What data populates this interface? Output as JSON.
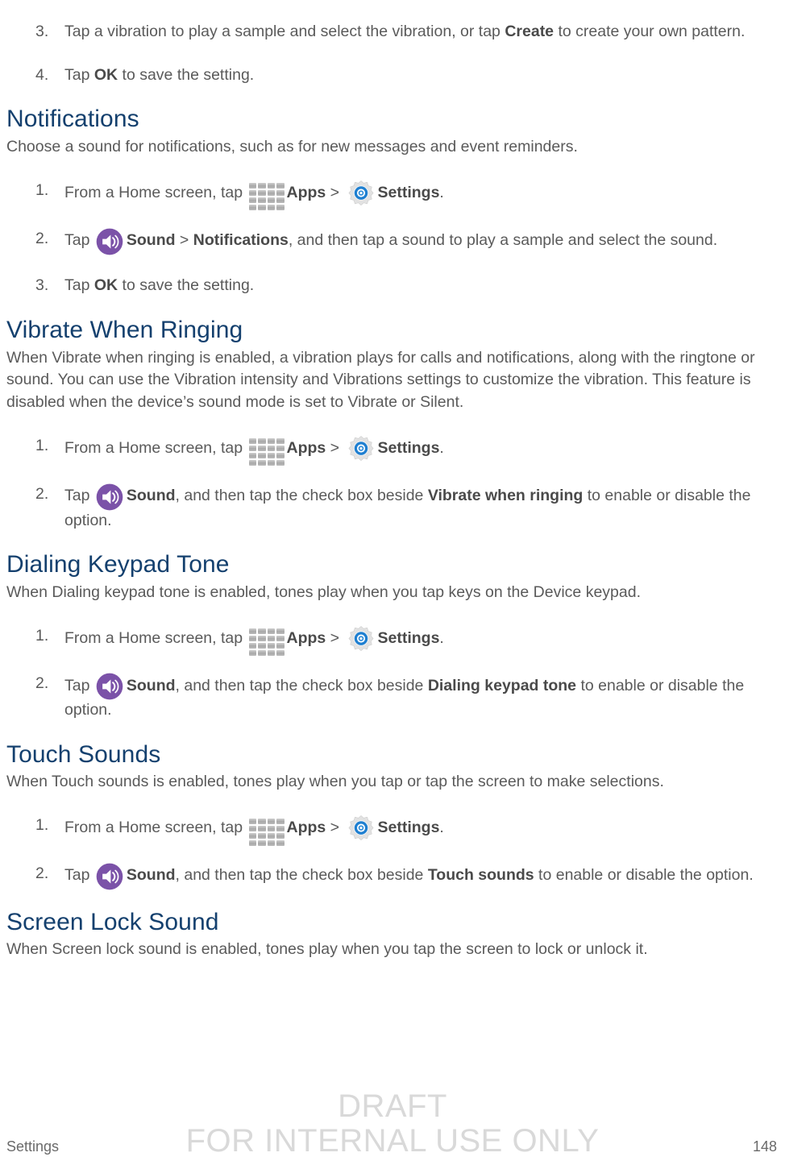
{
  "document": {
    "footer": {
      "left_label": "Settings",
      "page_number": "148",
      "watermark_line1": "DRAFT",
      "watermark_line2": "FOR INTERNAL USE ONLY"
    },
    "colors": {
      "heading": "#14406e",
      "body_text": "#5a5a5a",
      "sound_icon_purple": "#7b52a8",
      "settings_icon_blue": "#1a7fd4",
      "apps_icon_gray": "#a8a8a8",
      "watermark": "#d9d9d9"
    },
    "icons": {
      "apps": "apps-grid-icon",
      "settings": "gear-icon",
      "sound": "sound-speaker-icon"
    },
    "labels": {
      "apps": "Apps",
      "settings": "Settings",
      "sound": "Sound",
      "separator": ">"
    },
    "continued_steps": [
      {
        "num": "3.",
        "parts": [
          {
            "t": "Tap a vibration to play a sample and select the vibration, or tap "
          },
          {
            "t": "Create",
            "b": true
          },
          {
            "t": " to create your own pattern."
          }
        ]
      },
      {
        "num": "4.",
        "parts": [
          {
            "t": "Tap "
          },
          {
            "t": "OK",
            "b": true
          },
          {
            "t": " to save the setting."
          }
        ]
      }
    ],
    "sections": [
      {
        "id": "notifications",
        "heading": "Notifications",
        "intro": "Choose a sound for notifications, such as for new messages and event reminders.",
        "steps": [
          {
            "num": "1.",
            "parts": [
              {
                "t": "From a Home screen, tap "
              },
              {
                "icon": "apps"
              },
              {
                "t": "Apps",
                "b": true
              },
              {
                "t": " > "
              },
              {
                "icon": "settings"
              },
              {
                "t": "Settings",
                "b": true
              },
              {
                "t": "."
              }
            ]
          },
          {
            "num": "2.",
            "parts": [
              {
                "t": "Tap "
              },
              {
                "icon": "sound"
              },
              {
                "t": "Sound",
                "b": true
              },
              {
                "t": " > "
              },
              {
                "t": "Notifications",
                "b": true
              },
              {
                "t": ", and then tap a sound to play a sample and select the sound."
              }
            ]
          },
          {
            "num": "3.",
            "parts": [
              {
                "t": "Tap "
              },
              {
                "t": "OK",
                "b": true
              },
              {
                "t": " to save the setting."
              }
            ]
          }
        ]
      },
      {
        "id": "vibrate-when-ringing",
        "heading": "Vibrate When Ringing",
        "intro": "When Vibrate when ringing is enabled, a vibration plays for calls and notifications, along with the ringtone or sound. You can use the Vibration intensity and Vibrations settings to customize the vibration. This feature is disabled when the device’s sound mode is set to Vibrate or Silent.",
        "steps": [
          {
            "num": "1.",
            "parts": [
              {
                "t": "From a Home screen, tap "
              },
              {
                "icon": "apps"
              },
              {
                "t": "Apps",
                "b": true
              },
              {
                "t": " > "
              },
              {
                "icon": "settings"
              },
              {
                "t": "Settings",
                "b": true
              },
              {
                "t": "."
              }
            ]
          },
          {
            "num": "2.",
            "parts": [
              {
                "t": "Tap "
              },
              {
                "icon": "sound"
              },
              {
                "t": "Sound",
                "b": true
              },
              {
                "t": ", and then tap the check box beside "
              },
              {
                "t": "Vibrate when ringing",
                "b": true
              },
              {
                "t": " to enable or disable the option."
              }
            ]
          }
        ]
      },
      {
        "id": "dialing-keypad-tone",
        "heading": "Dialing Keypad Tone",
        "intro": "When Dialing keypad tone is enabled, tones play when you tap keys on the Device keypad.",
        "steps": [
          {
            "num": "1.",
            "parts": [
              {
                "t": "From a Home screen, tap "
              },
              {
                "icon": "apps"
              },
              {
                "t": "Apps",
                "b": true
              },
              {
                "t": " > "
              },
              {
                "icon": "settings"
              },
              {
                "t": "Settings",
                "b": true
              },
              {
                "t": "."
              }
            ]
          },
          {
            "num": "2.",
            "parts": [
              {
                "t": "Tap "
              },
              {
                "icon": "sound"
              },
              {
                "t": "Sound",
                "b": true
              },
              {
                "t": ", and then tap the check box beside "
              },
              {
                "t": "Dialing keypad tone",
                "b": true
              },
              {
                "t": " to enable or disable the option."
              }
            ]
          }
        ]
      },
      {
        "id": "touch-sounds",
        "heading": "Touch Sounds",
        "intro": "When Touch sounds is enabled, tones play when you tap or tap the screen to make selections.",
        "steps": [
          {
            "num": "1.",
            "parts": [
              {
                "t": "From a Home screen, tap "
              },
              {
                "icon": "apps"
              },
              {
                "t": "Apps",
                "b": true
              },
              {
                "t": " > "
              },
              {
                "icon": "settings"
              },
              {
                "t": "Settings",
                "b": true
              },
              {
                "t": "."
              }
            ]
          },
          {
            "num": "2.",
            "parts": [
              {
                "t": "Tap "
              },
              {
                "icon": "sound"
              },
              {
                "t": "Sound",
                "b": true
              },
              {
                "t": ", and then tap the check box beside "
              },
              {
                "t": "Touch sounds",
                "b": true
              },
              {
                "t": " to enable or disable the option."
              }
            ]
          }
        ]
      },
      {
        "id": "screen-lock-sound",
        "heading": "Screen Lock Sound",
        "intro": "When Screen lock sound is enabled, tones play when you tap the screen to lock or unlock it.",
        "steps": []
      }
    ]
  }
}
